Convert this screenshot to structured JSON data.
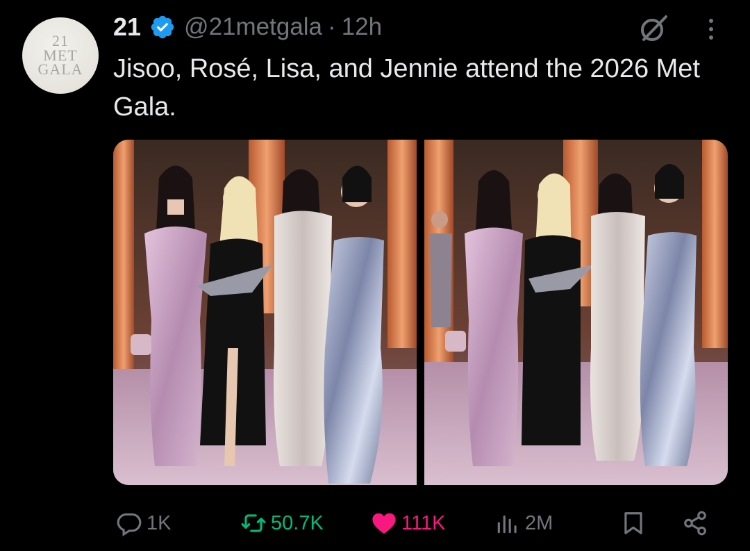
{
  "author": {
    "avatar_lines": [
      "21",
      "MET",
      "GALA"
    ],
    "display_name": "21",
    "handle": "@21metgala",
    "separator": "·",
    "time": "12h",
    "verified": true
  },
  "tweet": {
    "text": "Jisoo, Rosé, Lisa, and Jennie attend the 2026 Met Gala."
  },
  "media": {
    "count": 2
  },
  "actions": {
    "replies": "1K",
    "reposts": "50.7K",
    "likes": "111K",
    "views": "2M"
  },
  "colors": {
    "background": "#000000",
    "text": "#e7e9ea",
    "secondary": "#71767b",
    "verified": "#1d9bf0",
    "repost_active": "#00ba7c",
    "like_active": "#f91880"
  },
  "icons": [
    "verified-badge-icon",
    "grok-icon",
    "more-icon",
    "reply-icon",
    "repost-icon",
    "like-icon",
    "views-icon",
    "bookmark-icon",
    "share-icon"
  ]
}
